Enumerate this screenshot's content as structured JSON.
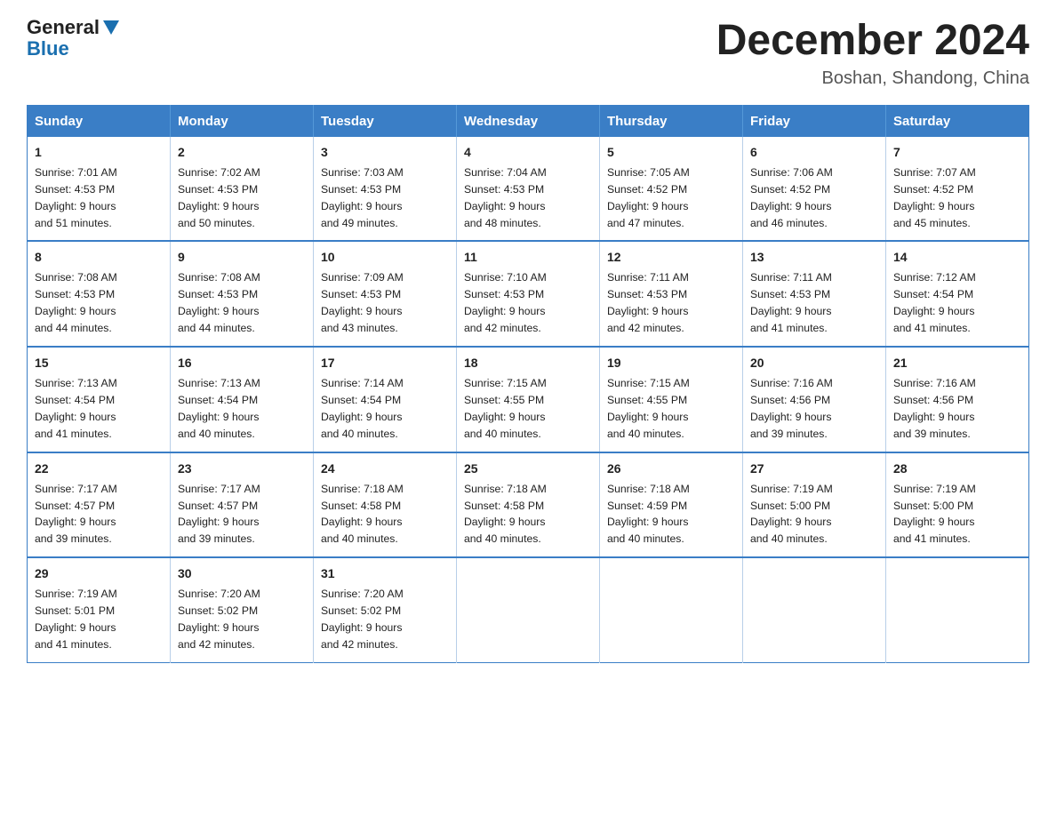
{
  "logo": {
    "general": "General",
    "blue": "Blue"
  },
  "header": {
    "title": "December 2024",
    "location": "Boshan, Shandong, China"
  },
  "days_of_week": [
    "Sunday",
    "Monday",
    "Tuesday",
    "Wednesday",
    "Thursday",
    "Friday",
    "Saturday"
  ],
  "weeks": [
    [
      {
        "day": "1",
        "sunrise": "7:01 AM",
        "sunset": "4:53 PM",
        "daylight": "9 hours and 51 minutes."
      },
      {
        "day": "2",
        "sunrise": "7:02 AM",
        "sunset": "4:53 PM",
        "daylight": "9 hours and 50 minutes."
      },
      {
        "day": "3",
        "sunrise": "7:03 AM",
        "sunset": "4:53 PM",
        "daylight": "9 hours and 49 minutes."
      },
      {
        "day": "4",
        "sunrise": "7:04 AM",
        "sunset": "4:53 PM",
        "daylight": "9 hours and 48 minutes."
      },
      {
        "day": "5",
        "sunrise": "7:05 AM",
        "sunset": "4:52 PM",
        "daylight": "9 hours and 47 minutes."
      },
      {
        "day": "6",
        "sunrise": "7:06 AM",
        "sunset": "4:52 PM",
        "daylight": "9 hours and 46 minutes."
      },
      {
        "day": "7",
        "sunrise": "7:07 AM",
        "sunset": "4:52 PM",
        "daylight": "9 hours and 45 minutes."
      }
    ],
    [
      {
        "day": "8",
        "sunrise": "7:08 AM",
        "sunset": "4:53 PM",
        "daylight": "9 hours and 44 minutes."
      },
      {
        "day": "9",
        "sunrise": "7:08 AM",
        "sunset": "4:53 PM",
        "daylight": "9 hours and 44 minutes."
      },
      {
        "day": "10",
        "sunrise": "7:09 AM",
        "sunset": "4:53 PM",
        "daylight": "9 hours and 43 minutes."
      },
      {
        "day": "11",
        "sunrise": "7:10 AM",
        "sunset": "4:53 PM",
        "daylight": "9 hours and 42 minutes."
      },
      {
        "day": "12",
        "sunrise": "7:11 AM",
        "sunset": "4:53 PM",
        "daylight": "9 hours and 42 minutes."
      },
      {
        "day": "13",
        "sunrise": "7:11 AM",
        "sunset": "4:53 PM",
        "daylight": "9 hours and 41 minutes."
      },
      {
        "day": "14",
        "sunrise": "7:12 AM",
        "sunset": "4:54 PM",
        "daylight": "9 hours and 41 minutes."
      }
    ],
    [
      {
        "day": "15",
        "sunrise": "7:13 AM",
        "sunset": "4:54 PM",
        "daylight": "9 hours and 41 minutes."
      },
      {
        "day": "16",
        "sunrise": "7:13 AM",
        "sunset": "4:54 PM",
        "daylight": "9 hours and 40 minutes."
      },
      {
        "day": "17",
        "sunrise": "7:14 AM",
        "sunset": "4:54 PM",
        "daylight": "9 hours and 40 minutes."
      },
      {
        "day": "18",
        "sunrise": "7:15 AM",
        "sunset": "4:55 PM",
        "daylight": "9 hours and 40 minutes."
      },
      {
        "day": "19",
        "sunrise": "7:15 AM",
        "sunset": "4:55 PM",
        "daylight": "9 hours and 40 minutes."
      },
      {
        "day": "20",
        "sunrise": "7:16 AM",
        "sunset": "4:56 PM",
        "daylight": "9 hours and 39 minutes."
      },
      {
        "day": "21",
        "sunrise": "7:16 AM",
        "sunset": "4:56 PM",
        "daylight": "9 hours and 39 minutes."
      }
    ],
    [
      {
        "day": "22",
        "sunrise": "7:17 AM",
        "sunset": "4:57 PM",
        "daylight": "9 hours and 39 minutes."
      },
      {
        "day": "23",
        "sunrise": "7:17 AM",
        "sunset": "4:57 PM",
        "daylight": "9 hours and 39 minutes."
      },
      {
        "day": "24",
        "sunrise": "7:18 AM",
        "sunset": "4:58 PM",
        "daylight": "9 hours and 40 minutes."
      },
      {
        "day": "25",
        "sunrise": "7:18 AM",
        "sunset": "4:58 PM",
        "daylight": "9 hours and 40 minutes."
      },
      {
        "day": "26",
        "sunrise": "7:18 AM",
        "sunset": "4:59 PM",
        "daylight": "9 hours and 40 minutes."
      },
      {
        "day": "27",
        "sunrise": "7:19 AM",
        "sunset": "5:00 PM",
        "daylight": "9 hours and 40 minutes."
      },
      {
        "day": "28",
        "sunrise": "7:19 AM",
        "sunset": "5:00 PM",
        "daylight": "9 hours and 41 minutes."
      }
    ],
    [
      {
        "day": "29",
        "sunrise": "7:19 AM",
        "sunset": "5:01 PM",
        "daylight": "9 hours and 41 minutes."
      },
      {
        "day": "30",
        "sunrise": "7:20 AM",
        "sunset": "5:02 PM",
        "daylight": "9 hours and 42 minutes."
      },
      {
        "day": "31",
        "sunrise": "7:20 AM",
        "sunset": "5:02 PM",
        "daylight": "9 hours and 42 minutes."
      },
      null,
      null,
      null,
      null
    ]
  ]
}
